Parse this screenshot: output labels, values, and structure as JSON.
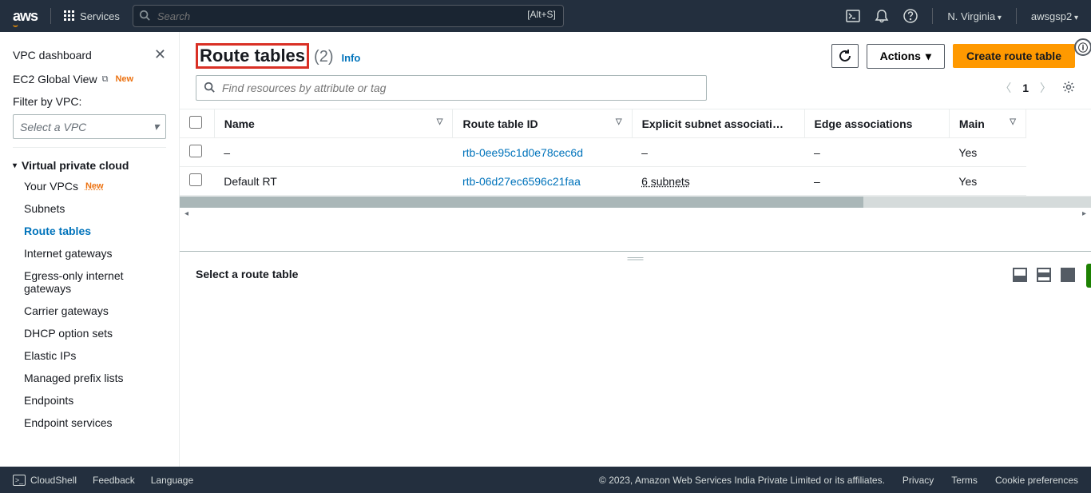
{
  "topnav": {
    "logo": "aws",
    "services": "Services",
    "search_placeholder": "Search",
    "search_shortcut": "[Alt+S]",
    "region": "N. Virginia",
    "account": "awsgsp2"
  },
  "sidebar": {
    "dashboard": "VPC dashboard",
    "ec2_global": "EC2 Global View",
    "new_badge": "New",
    "filter_label": "Filter by VPC:",
    "vpc_select_placeholder": "Select a VPC",
    "section_vpc": "Virtual private cloud",
    "items": [
      "Your VPCs",
      "Subnets",
      "Route tables",
      "Internet gateways",
      "Egress-only internet gateways",
      "Carrier gateways",
      "DHCP option sets",
      "Elastic IPs",
      "Managed prefix lists",
      "Endpoints",
      "Endpoint services"
    ]
  },
  "content": {
    "title": "Route tables",
    "count": "(2)",
    "info": "Info",
    "actions_label": "Actions",
    "create_label": "Create route table",
    "search_placeholder": "Find resources by attribute or tag",
    "page_num": "1",
    "columns": {
      "name": "Name",
      "rtid": "Route table ID",
      "subnet": "Explicit subnet associati…",
      "edge": "Edge associations",
      "main": "Main"
    },
    "rows": [
      {
        "name": "–",
        "rtid": "rtb-0ee95c1d0e78cec6d",
        "subnet": "–",
        "edge": "–",
        "main": "Yes"
      },
      {
        "name": "Default RT",
        "rtid": "rtb-06d27ec6596c21faa",
        "subnet": "6 subnets",
        "edge": "–",
        "main": "Yes"
      }
    ],
    "detail_msg": "Select a route table"
  },
  "footer": {
    "cloudshell": "CloudShell",
    "feedback": "Feedback",
    "language": "Language",
    "copyright": "© 2023, Amazon Web Services India Private Limited or its affiliates.",
    "privacy": "Privacy",
    "terms": "Terms",
    "cookies": "Cookie preferences"
  }
}
